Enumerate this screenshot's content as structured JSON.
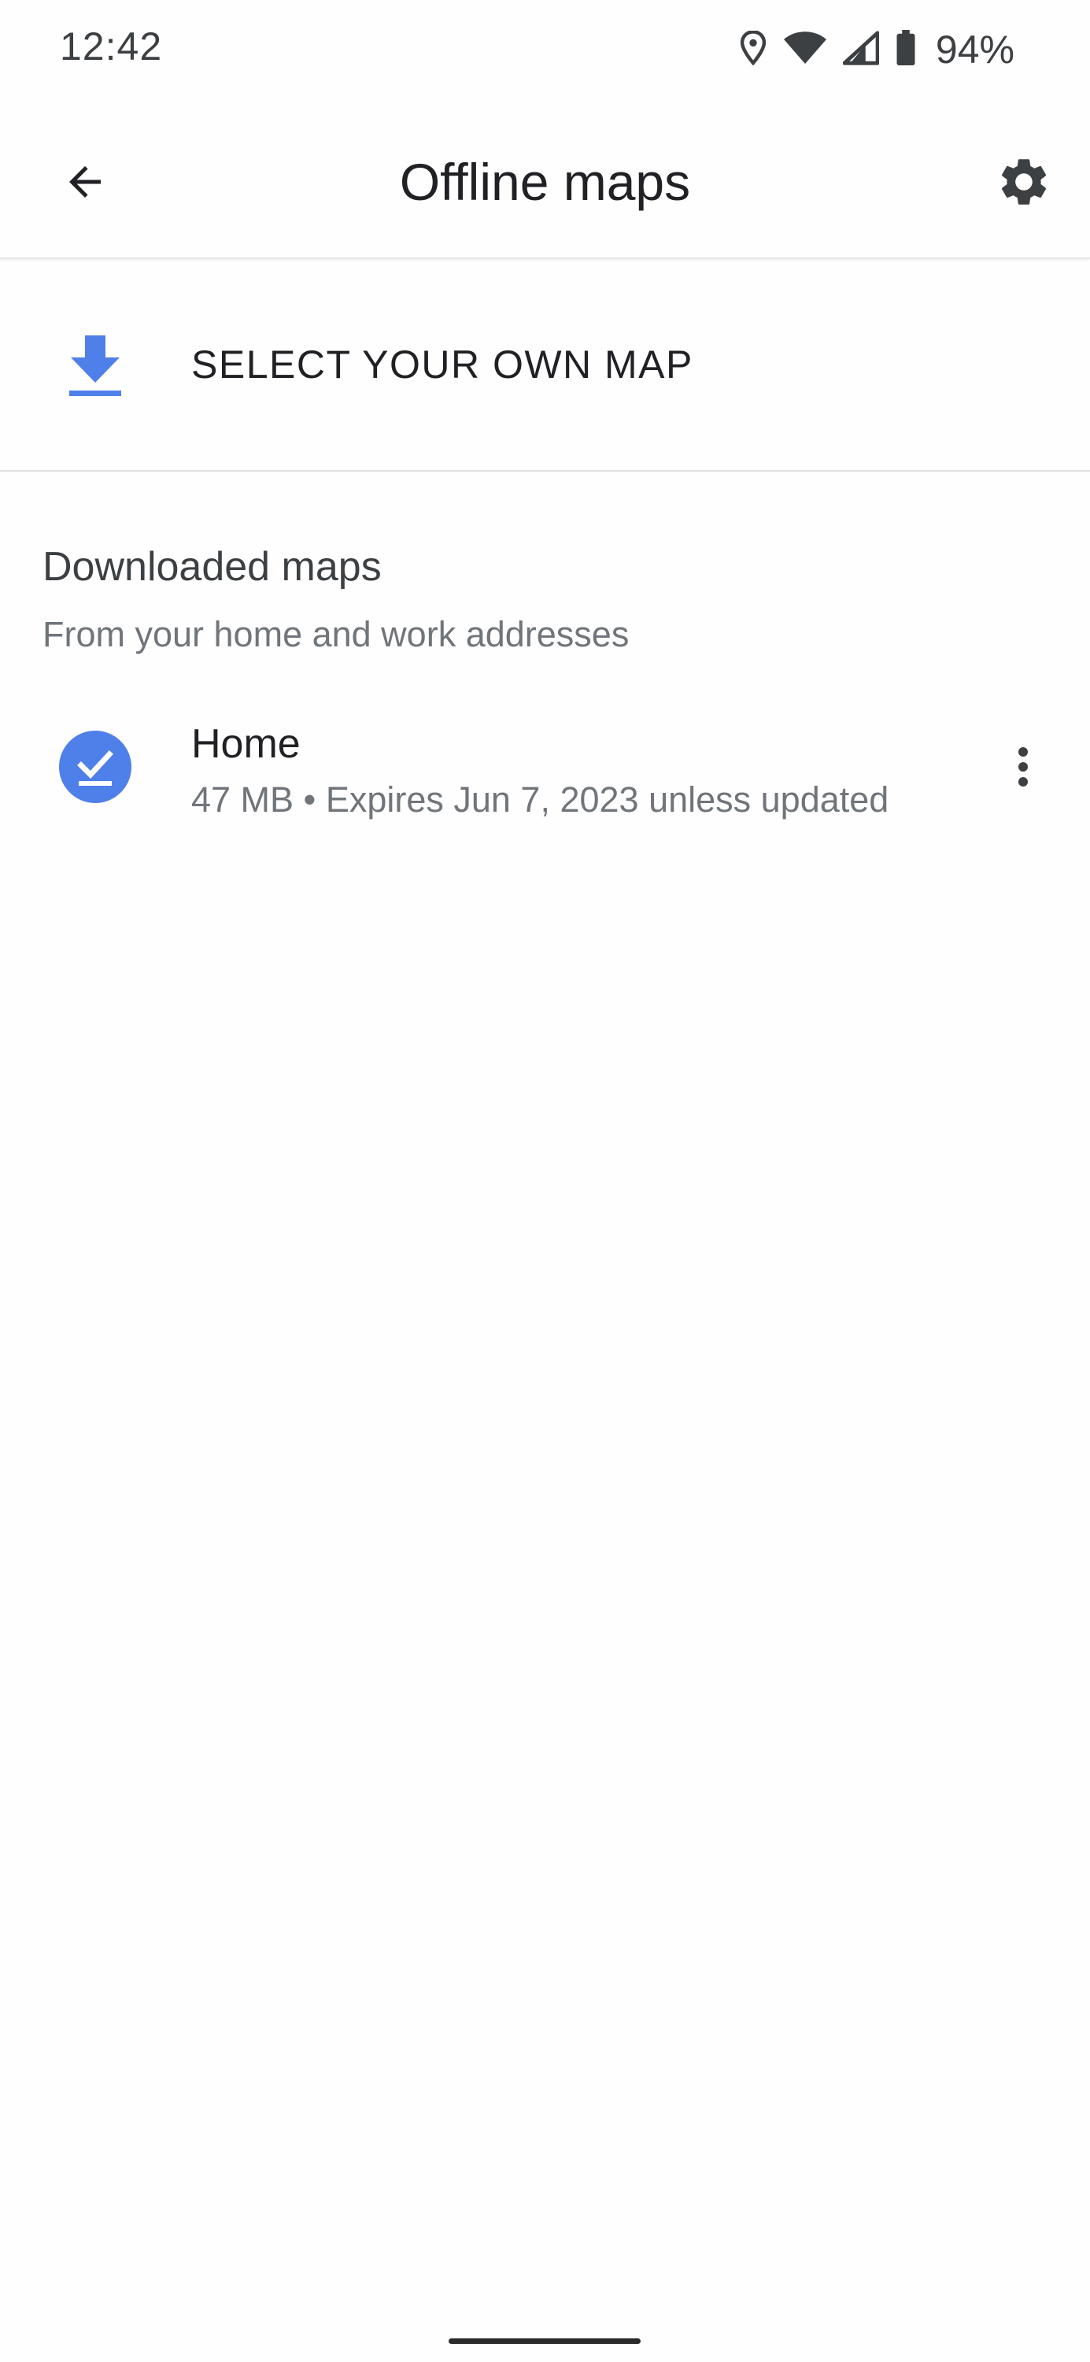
{
  "status_bar": {
    "time": "12:42",
    "battery": "94%",
    "icons": [
      "location-icon",
      "wifi-icon",
      "signal-icon",
      "battery-icon"
    ]
  },
  "app_bar": {
    "title": "Offline maps",
    "back_icon": "arrow-back-icon",
    "settings_icon": "gear-icon"
  },
  "select_map": {
    "label": "SELECT YOUR OWN MAP",
    "icon": "download-icon"
  },
  "downloaded": {
    "title": "Downloaded maps",
    "subtitle": "From your home and work addresses",
    "items": [
      {
        "name": "Home",
        "details": "47 MB • Expires Jun 7, 2023 unless updated",
        "icon": "download-done-icon"
      }
    ]
  },
  "colors": {
    "accent": "#4f7fe8",
    "text_primary": "#202124",
    "text_secondary": "#70757a",
    "divider": "#e0e0e0"
  }
}
